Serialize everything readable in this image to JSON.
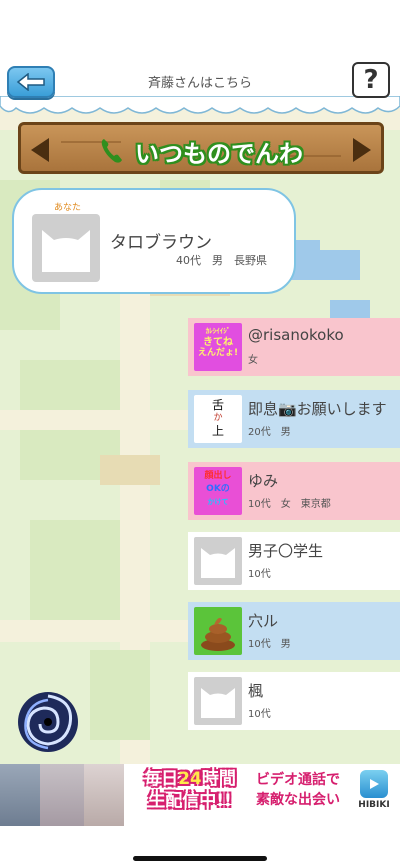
{
  "header": {
    "title": "斉藤さんはこちら",
    "help_label": "?"
  },
  "sign": {
    "label": "いつものでんわ"
  },
  "my_card": {
    "you_label": "あなた",
    "name": "タロブラウン",
    "info": "40代　男　長野県"
  },
  "list": [
    {
      "name": "@risanokoko",
      "sub": "女",
      "color": "#f9c5cd",
      "thumb": "sticker"
    },
    {
      "name": "即息📷お願いします",
      "sub": "20代　男",
      "color": "#c3def2",
      "thumb": "handwriting"
    },
    {
      "name": "ゆみ",
      "sub": "10代　女　東京都",
      "color": "#f9c5cd",
      "thumb": "sticker"
    },
    {
      "name": "男子〇学生",
      "sub": "10代",
      "color": "#ffffff",
      "thumb": "cat-icon"
    },
    {
      "name": "穴ル",
      "sub": "10代　男",
      "color": "#c3def2",
      "thumb": "poop-icon"
    },
    {
      "name": "楓",
      "sub": "10代",
      "color": "#ffffff",
      "thumb": "cat-icon"
    }
  ],
  "thumb_texts": {
    "t1_line1": "ｶﾚｼｲｲｼﾞ",
    "t1_line2": "きてね",
    "t1_line3": "えんだょ!",
    "t2_line1": "舌",
    "t2_line2": "か",
    "t2_line3": "上",
    "t3_line1": "顔出し",
    "t3_line2": "OKの",
    "t3_line3": "かけて"
  },
  "ad": {
    "headline_a": "毎日",
    "headline_num": "24",
    "headline_b": "時間",
    "headline_line2": "生配信中!!",
    "copy_line1": "ビデオ通話で",
    "copy_line2": "素敵な出会い",
    "brand": "HIBIKI"
  }
}
